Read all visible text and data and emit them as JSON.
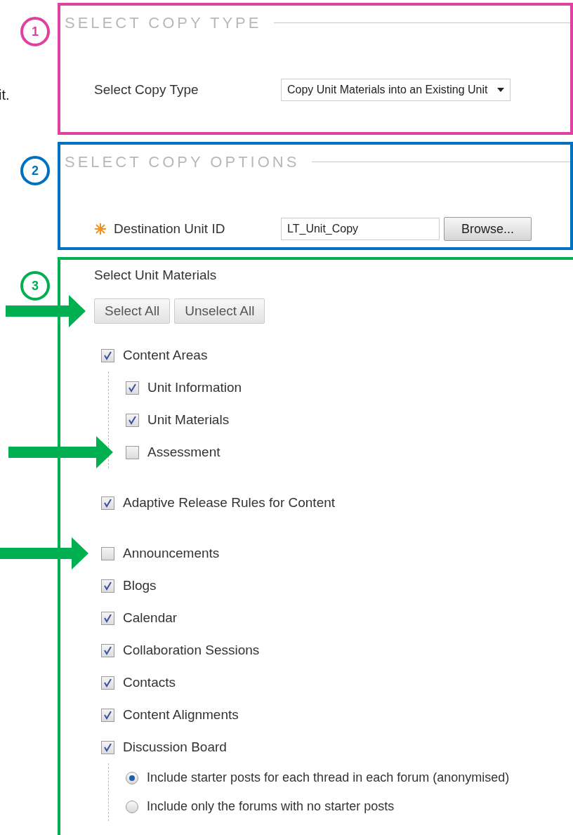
{
  "note_fragment": "it.",
  "sections": [
    {
      "number": "1",
      "color": "#e040a0",
      "title": "SELECT COPY TYPE",
      "field": {
        "kind": "select",
        "label": "Select Copy Type",
        "value": "Copy Unit Materials into an Existing Unit"
      }
    },
    {
      "number": "2",
      "color": "#0070c0",
      "title": "SELECT COPY OPTIONS",
      "field": {
        "kind": "text",
        "label": "Destination Unit ID",
        "required": true,
        "value": "LT_Unit_Copy",
        "button": "Browse..."
      }
    },
    {
      "number": "3",
      "color": "#00b050",
      "heading": "Select Unit Materials",
      "buttons": {
        "annotated": true,
        "labels": [
          "Select All",
          "Unselect All"
        ]
      },
      "groups": [
        {
          "items": [
            {
              "label": "Content Areas",
              "checked": true,
              "annotated": false,
              "children": [
                {
                  "label": "Unit Information",
                  "checked": true,
                  "annotated": false
                },
                {
                  "label": "Unit Materials",
                  "checked": true,
                  "annotated": false
                },
                {
                  "label": "Assessment",
                  "checked": false,
                  "annotated": true
                }
              ]
            }
          ]
        },
        {
          "items": [
            {
              "label": "Adaptive Release Rules for Content",
              "checked": true,
              "annotated": false
            }
          ]
        },
        {
          "items": [
            {
              "label": "Announcements",
              "checked": false,
              "annotated": true
            },
            {
              "label": "Blogs",
              "checked": true,
              "annotated": false
            },
            {
              "label": "Calendar",
              "checked": true,
              "annotated": false
            },
            {
              "label": "Collaboration Sessions",
              "checked": true,
              "annotated": false
            },
            {
              "label": "Contacts",
              "checked": true,
              "annotated": false
            },
            {
              "label": "Content Alignments",
              "checked": true,
              "annotated": false
            },
            {
              "label": "Discussion Board",
              "checked": true,
              "annotated": false,
              "options": [
                {
                  "label": "Include starter posts for each thread in each forum (anonymised)",
                  "selected": true
                },
                {
                  "label": "Include only the forums with no starter posts",
                  "selected": false
                }
              ]
            }
          ]
        }
      ]
    }
  ]
}
